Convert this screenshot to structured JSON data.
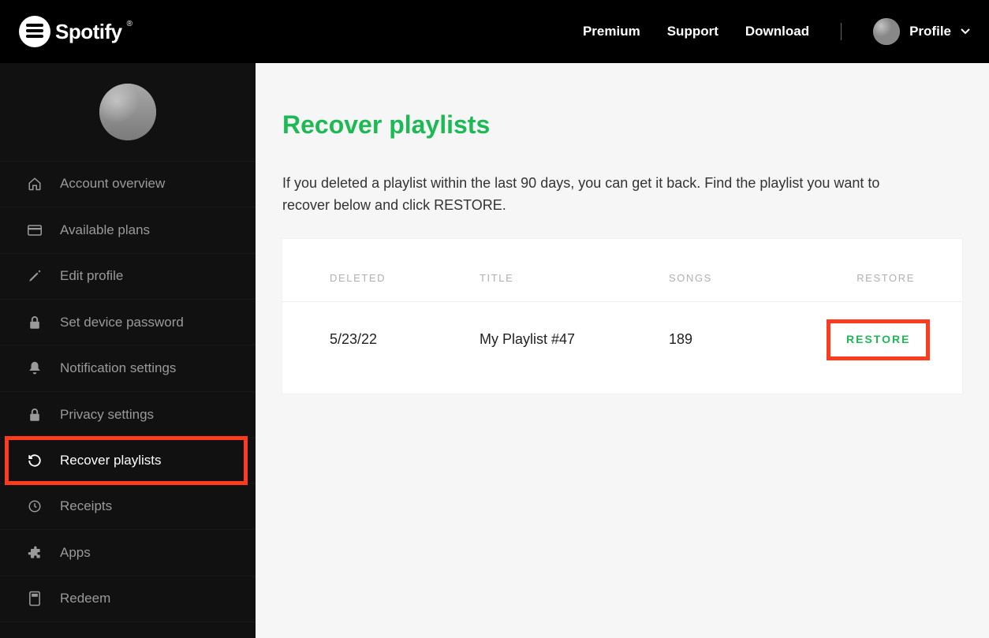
{
  "brand": {
    "name": "Spotify"
  },
  "header": {
    "nav": {
      "premium": "Premium",
      "support": "Support",
      "download": "Download"
    },
    "profile_label": "Profile"
  },
  "sidebar": {
    "items": [
      {
        "label": "Account overview",
        "icon": "home-icon"
      },
      {
        "label": "Available plans",
        "icon": "card-icon"
      },
      {
        "label": "Edit profile",
        "icon": "pencil-icon"
      },
      {
        "label": "Set device password",
        "icon": "lock-icon"
      },
      {
        "label": "Notification settings",
        "icon": "bell-icon"
      },
      {
        "label": "Privacy settings",
        "icon": "lock-icon"
      },
      {
        "label": "Recover playlists",
        "icon": "refresh-icon"
      },
      {
        "label": "Receipts",
        "icon": "clock-icon"
      },
      {
        "label": "Apps",
        "icon": "puzzle-icon"
      },
      {
        "label": "Redeem",
        "icon": "voucher-icon"
      }
    ]
  },
  "main": {
    "title": "Recover playlists",
    "description": "If you deleted a playlist within the last 90 days, you can get it back. Find the playlist you want to recover below and click RESTORE.",
    "table": {
      "columns": {
        "deleted": "DELETED",
        "title": "TITLE",
        "songs": "SONGS",
        "restore": "RESTORE"
      },
      "rows": [
        {
          "deleted": "5/23/22",
          "title": "My Playlist #47",
          "songs": "189",
          "restore_label": "RESTORE"
        }
      ]
    }
  }
}
